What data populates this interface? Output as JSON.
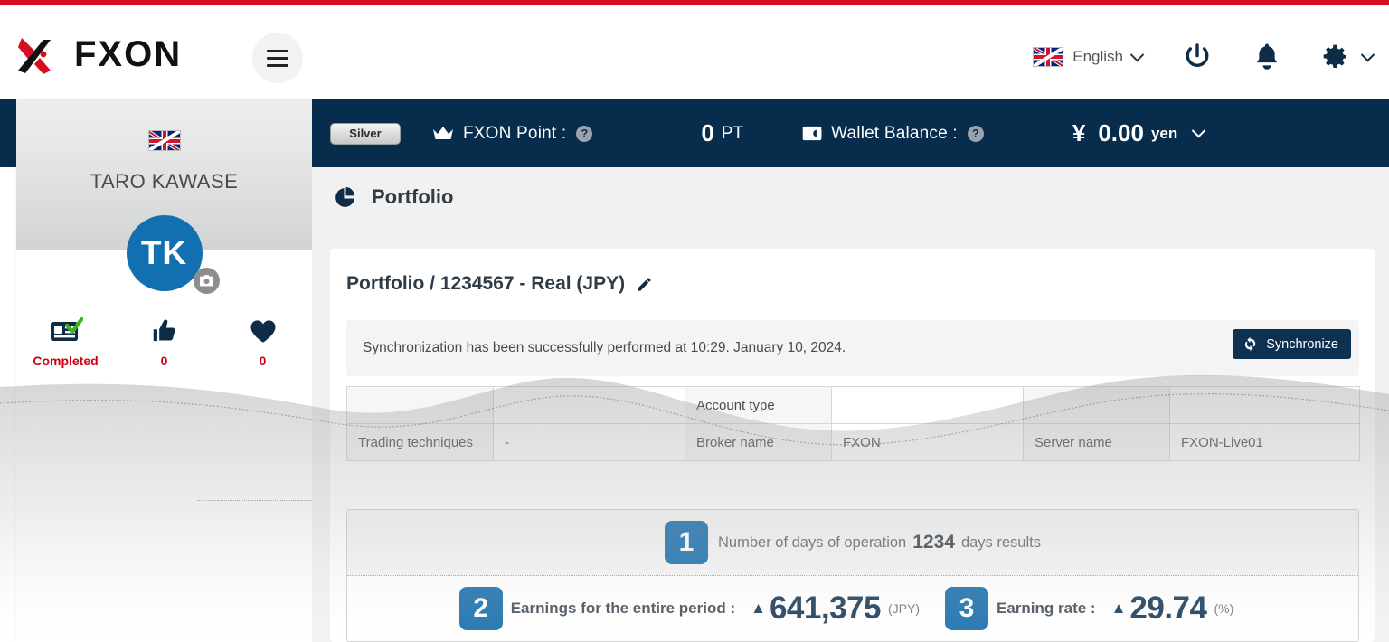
{
  "header": {
    "logo_text": "FXON",
    "menu_icon": "hamburger-icon",
    "language": "English",
    "power_icon": "power-icon",
    "bell_icon": "bell-icon",
    "gear_icon": "gear-icon",
    "flag": "uk-flag"
  },
  "subbar": {
    "rank_badge": "Silver",
    "point_label": "FXON Point :",
    "point_value": "0",
    "point_unit": "PT",
    "wallet_label": "Wallet Balance :",
    "wallet_symbol": "¥",
    "wallet_value": "0.00",
    "wallet_unit": "yen"
  },
  "sidebar": {
    "user_name": "TARO KAWASE",
    "avatar_initials": "TK",
    "flag": "uk-flag",
    "camera_icon": "camera-icon",
    "stats": [
      {
        "icon": "id-card-check-icon",
        "label": "Completed"
      },
      {
        "icon": "thumbs-up-icon",
        "label": "0"
      },
      {
        "icon": "heart-icon",
        "label": "0"
      }
    ]
  },
  "page": {
    "icon": "pie-chart-icon",
    "title": "Portfolio",
    "card_title": "Portfolio / 1234567 - Real (JPY)",
    "edit_icon": "pencil-icon",
    "sync_message": "Synchronization has been successfully performed at 10:29. January 10, 2024.",
    "sync_button": "Synchronize",
    "sync_icon": "refresh-icon"
  },
  "table": {
    "rows": [
      {
        "c1": "",
        "c2": "",
        "c3": "Account type",
        "c4": "",
        "c5": "",
        "c6": ""
      },
      {
        "c1": "Trading techniques",
        "c2": "-",
        "c3": "Broker name",
        "c4": "FXON",
        "c5": "Server name",
        "c6": "FXON-Live01"
      }
    ]
  },
  "stats_panel": {
    "row1": {
      "badge": "1",
      "label_pre": "Number of days of operation",
      "value": "1234",
      "label_post": "days results"
    },
    "row2": [
      {
        "badge": "2",
        "label": "Earnings for the entire period :",
        "arrow": "▲",
        "value": "641,375",
        "unit": "(JPY)"
      },
      {
        "badge": "3",
        "label": "Earning rate :",
        "arrow": "▲",
        "value": "29.74",
        "unit": "(%)"
      }
    ]
  },
  "colors": {
    "accent_red": "#d50f1f",
    "navy": "#072c4c",
    "badge_blue": "#0c67a8",
    "avatar_blue": "#1370b0",
    "stat_red": "#d00012"
  }
}
